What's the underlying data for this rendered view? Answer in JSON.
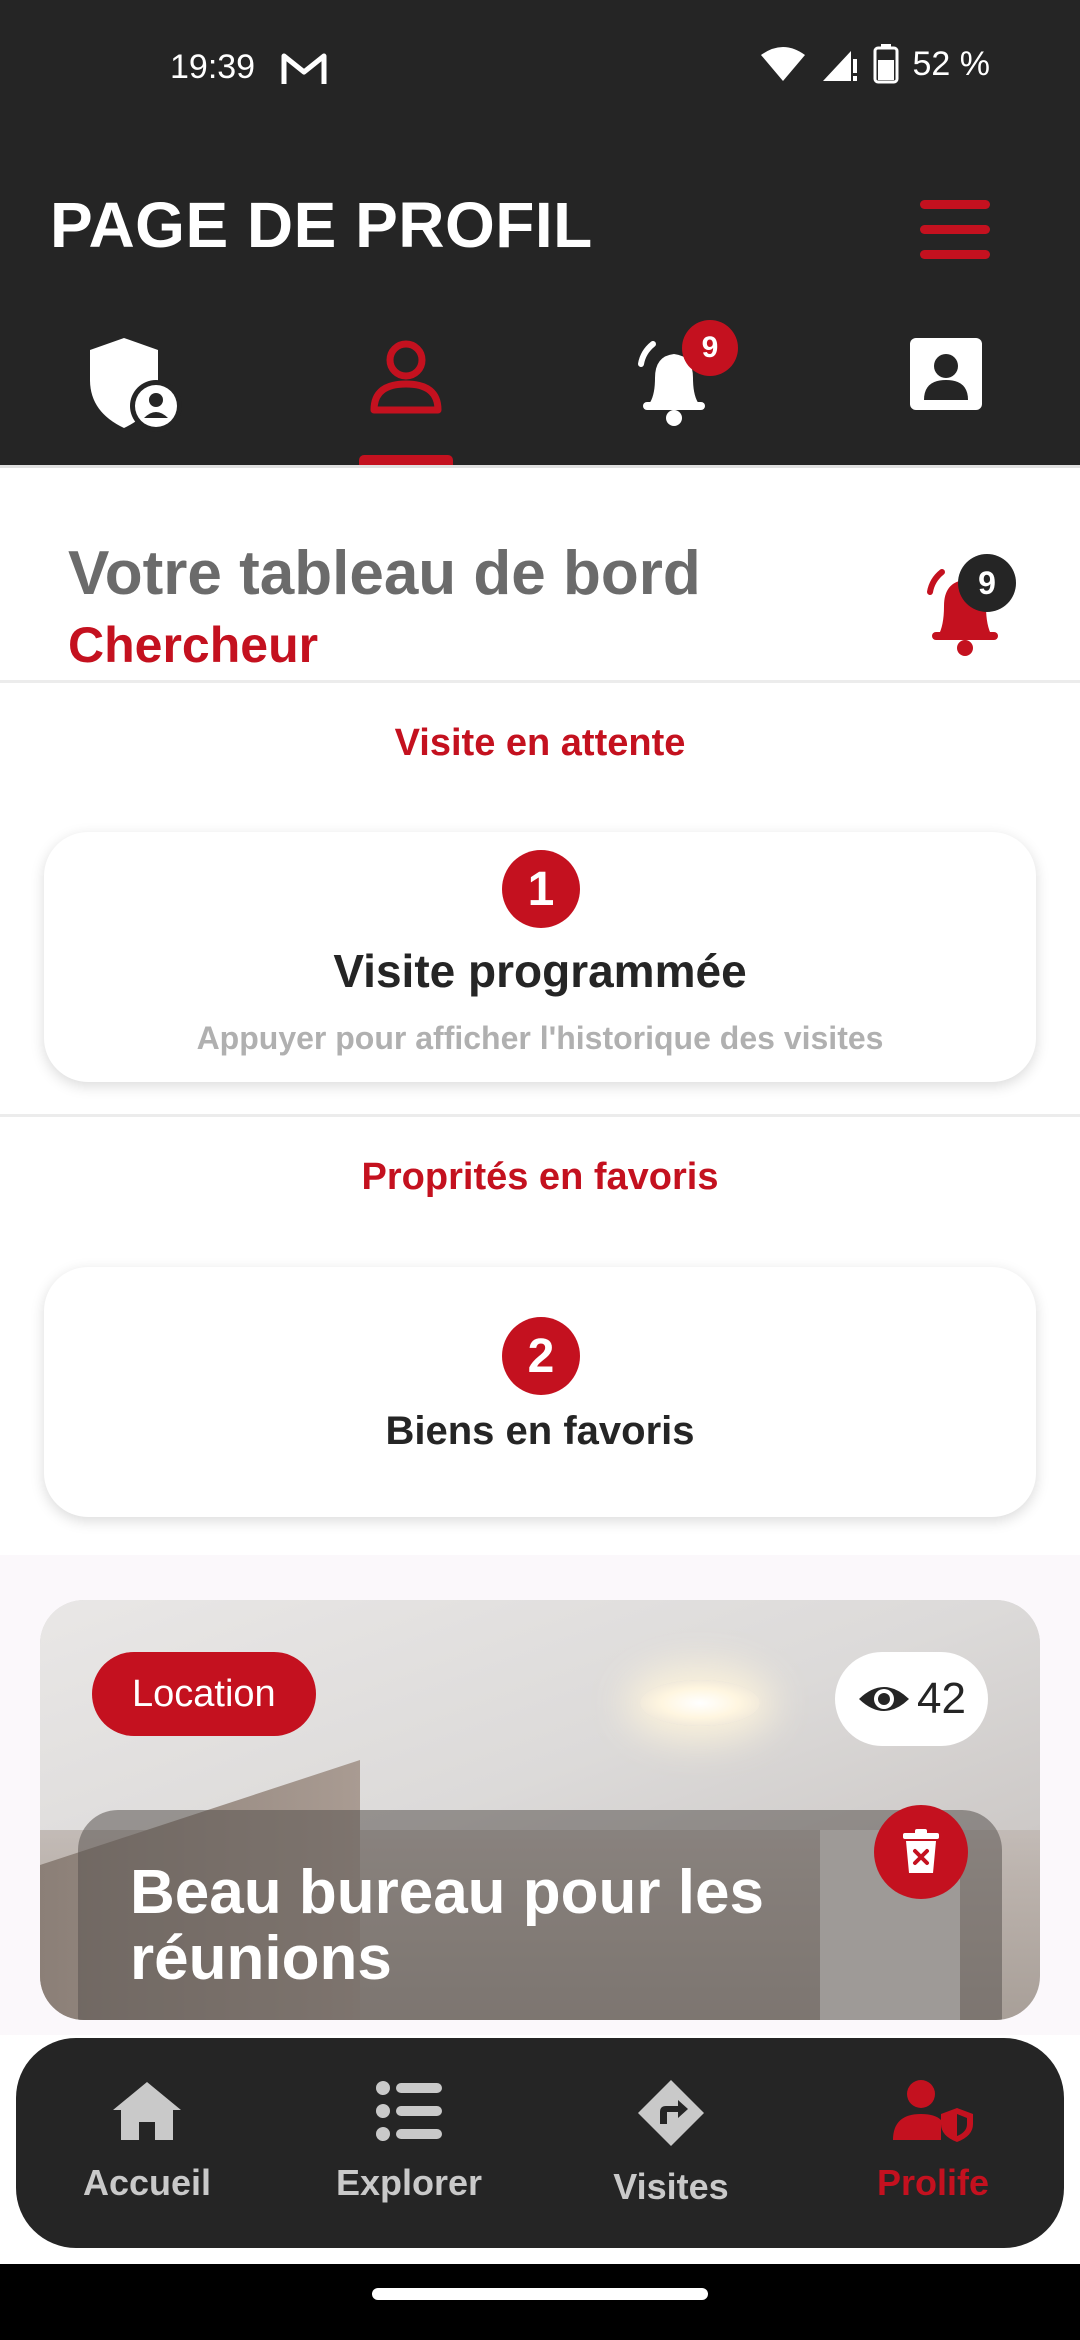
{
  "status_bar": {
    "time": "19:39",
    "battery": "52 %"
  },
  "header": {
    "title": "PAGE DE PROFIL"
  },
  "tabs": [
    {
      "name": "security",
      "active": false,
      "badge": ""
    },
    {
      "name": "profile",
      "active": true,
      "badge": ""
    },
    {
      "name": "notifications",
      "active": false,
      "badge": "9"
    },
    {
      "name": "contact-card",
      "active": false,
      "badge": ""
    }
  ],
  "dashboard": {
    "title": "Votre tableau de bord",
    "role": "Chercheur",
    "notification_count": "9"
  },
  "visits_section": {
    "title": "Visite en attente",
    "count": "1",
    "card_title": "Visite programmée",
    "card_subtitle": "Appuyer pour afficher l'historique des visites"
  },
  "favorites_section": {
    "title": "Proprités en favoris",
    "count": "2",
    "card_title": "Biens en favoris"
  },
  "property": {
    "tag": "Location",
    "views": "42",
    "title": "Beau bureau pour les réunions"
  },
  "bottom_nav": [
    {
      "label": "Accueil",
      "icon": "home-icon",
      "active": false
    },
    {
      "label": "Explorer",
      "icon": "list-icon",
      "active": false
    },
    {
      "label": "Visites",
      "icon": "directions-icon",
      "active": false
    },
    {
      "label": "Prolife",
      "icon": "user-shield-icon",
      "active": true
    }
  ],
  "colors": {
    "brand_red": "#c4111f",
    "dark": "#252525"
  }
}
